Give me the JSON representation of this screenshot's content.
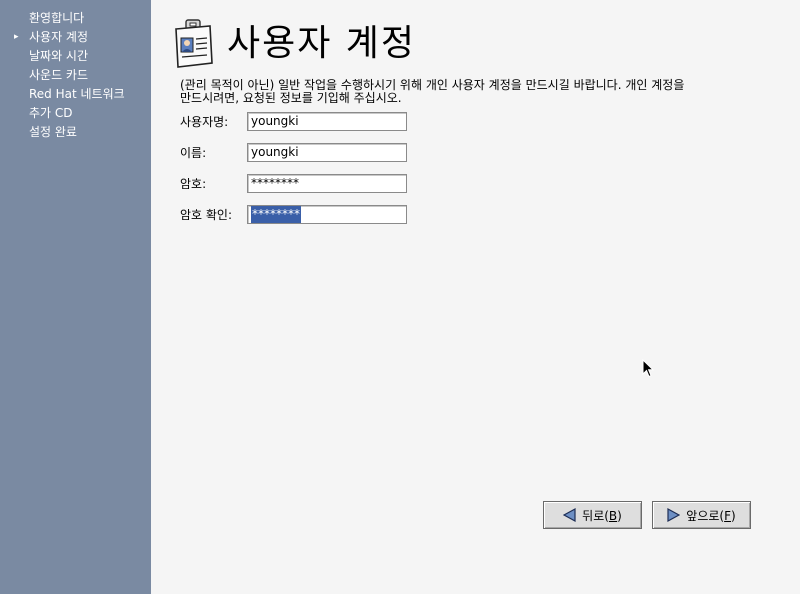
{
  "sidebar": {
    "items": [
      {
        "label": "환영합니다",
        "current": false
      },
      {
        "label": "사용자 계정",
        "current": true
      },
      {
        "label": "날짜와 시간",
        "current": false
      },
      {
        "label": "사운드 카드",
        "current": false
      },
      {
        "label": "Red Hat 네트워크",
        "current": false
      },
      {
        "label": "추가 CD",
        "current": false
      },
      {
        "label": "설정 완료",
        "current": false
      }
    ],
    "current_marker": "▸"
  },
  "header": {
    "title": "사용자 계정",
    "icon": "id-badge-icon"
  },
  "intro": {
    "text": "(관리 목적이 아닌) 일반 작업을 수행하시기 위해 개인 사용자 계정을 만드시길 바랍니다.  개인 계정을 만드시려면, 요청된 정보를 기입해 주십시오."
  },
  "form": {
    "username": {
      "label": "사용자명:",
      "value": "youngki"
    },
    "fullname": {
      "label": "이름:",
      "value": "youngki"
    },
    "password": {
      "label": "암호:",
      "value": "********"
    },
    "confirm": {
      "label": "암호 확인:",
      "value": "********"
    }
  },
  "buttons": {
    "back": {
      "label": "뒤로(",
      "mnemonic": "B",
      "suffix": ")"
    },
    "forward": {
      "label": "앞으로(",
      "mnemonic": "F",
      "suffix": ")"
    }
  }
}
